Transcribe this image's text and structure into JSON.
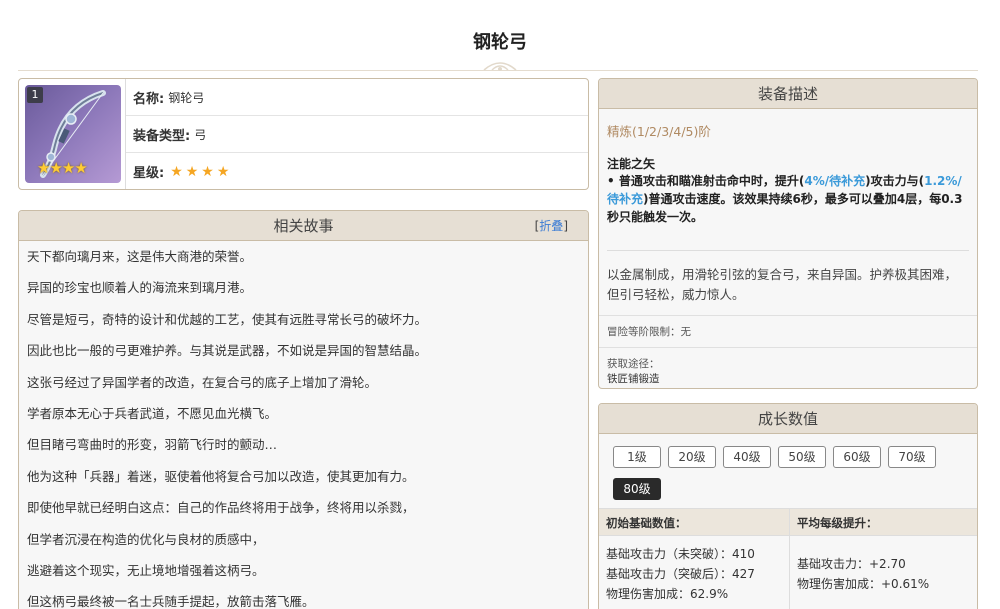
{
  "page": {
    "title": "钢轮弓"
  },
  "info": {
    "level_badge": "1",
    "name_label": "名称:",
    "name_value": "钢轮弓",
    "type_label": "装备类型:",
    "type_value": "弓",
    "rarity_label": "星级:",
    "rarity_stars": "★★★★",
    "portrait_stars": "★★★★"
  },
  "story": {
    "header": "相关故事",
    "collapse_open": "[",
    "collapse_label": "折叠",
    "collapse_close": "]",
    "lines": [
      "天下都向璃月来，这是伟大商港的荣誉。",
      "异国的珍宝也顺着人的海流来到璃月港。",
      "尽管是短弓，奇特的设计和优越的工艺，使其有远胜寻常长弓的破坏力。",
      "因此也比一般的弓更难护养。与其说是武器，不如说是异国的智慧结晶。",
      "这张弓经过了异国学者的改造，在复合弓的底子上增加了滑轮。",
      "学者原本无心于兵者武道，不愿见血光横飞。",
      "但目睹弓弯曲时的形变，羽箭飞行时的颤动…",
      "他为这种「兵器」着迷，驱使着他将复合弓加以改造，使其更加有力。",
      "即使他早就已经明白这点：自己的作品终将用于战争，终将用以杀戮，",
      "但学者沉浸在构造的优化与良材的质感中，",
      "逃避着这个现实，无止境地增强着这柄弓。",
      "但这柄弓最终被一名士兵随手提起，放箭击落飞雁。"
    ]
  },
  "description": {
    "header": "装备描述",
    "refine": "精炼(1/2/3/4/5)阶",
    "passive_name": "注能之矢",
    "passive_part1": "• 普通攻击和瞄准射击命中时，提升(",
    "passive_hl1": "4%/待补充",
    "passive_part2": ")攻击力与(",
    "passive_hl2": "1.2%/待补充",
    "passive_part3": ")普通攻击速度。该效果持续6秒，最多可以叠加4层，每0.3秒只能触发一次。",
    "flavor": "以金属制成，用滑轮引弦的复合弓，来自异国。护养极其困难，但引弓轻松，威力惊人。",
    "ascension_limit": "冒险等阶限制：无",
    "source_label": "获取途径：",
    "source_value": "铁匠铺锻造"
  },
  "growth": {
    "header": "成长数值",
    "levels": [
      "1级",
      "20级",
      "40级",
      "50级",
      "60级",
      "70级",
      "80级"
    ],
    "active_level": "80级",
    "base_header": "初始基础数值：",
    "avg_header": "平均每级提升：",
    "base_stats": [
      "基础攻击力（未突破）：410",
      "基础攻击力（突破后）：427",
      "物理伤害加成：62.9%"
    ],
    "avg_stats": [
      "基础攻击力：+2.70",
      "物理伤害加成：+0.61%"
    ]
  }
}
